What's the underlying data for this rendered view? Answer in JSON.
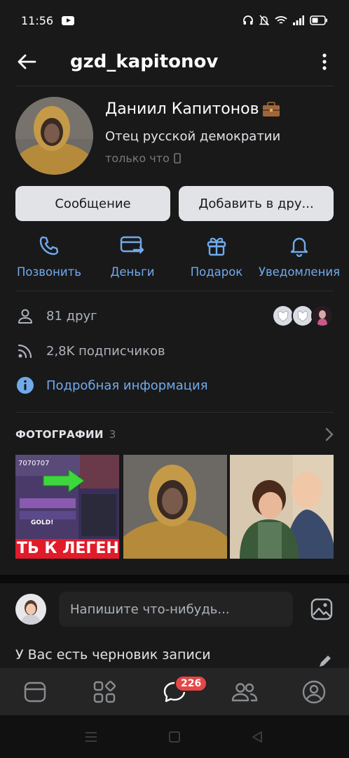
{
  "status_bar": {
    "time": "11:56"
  },
  "header": {
    "handle": "gzd_kapitonov"
  },
  "profile": {
    "name": "Даниил Капитонов",
    "status": "Отец русской демократии",
    "online": "только что"
  },
  "buttons": {
    "message": "Сообщение",
    "add_friend": "Добавить в дру..."
  },
  "actions": [
    {
      "label": "Позвонить",
      "icon": "phone-icon"
    },
    {
      "label": "Деньги",
      "icon": "money-transfer-icon"
    },
    {
      "label": "Подарок",
      "icon": "gift-icon"
    },
    {
      "label": "Уведомления",
      "icon": "bell-icon"
    }
  ],
  "info": {
    "friends": "81 друг",
    "followers": "2,8K подписчиков",
    "details_link": "Подробная информация"
  },
  "photos": {
    "title": "ФОТОГРАФИИ",
    "count": "3",
    "photo1_banner": "ТЬ К ЛЕГЕН",
    "photo1_top": "7070707",
    "photo1_gold": "GOLD!"
  },
  "composer": {
    "placeholder": "Напишите что-нибудь..."
  },
  "draft": {
    "text": "У Вас есть черновик записи"
  },
  "tab_bar": {
    "messages_badge": "226"
  },
  "colors": {
    "accent": "#71aaeb",
    "background": "#19191a",
    "badge": "#e64646"
  }
}
